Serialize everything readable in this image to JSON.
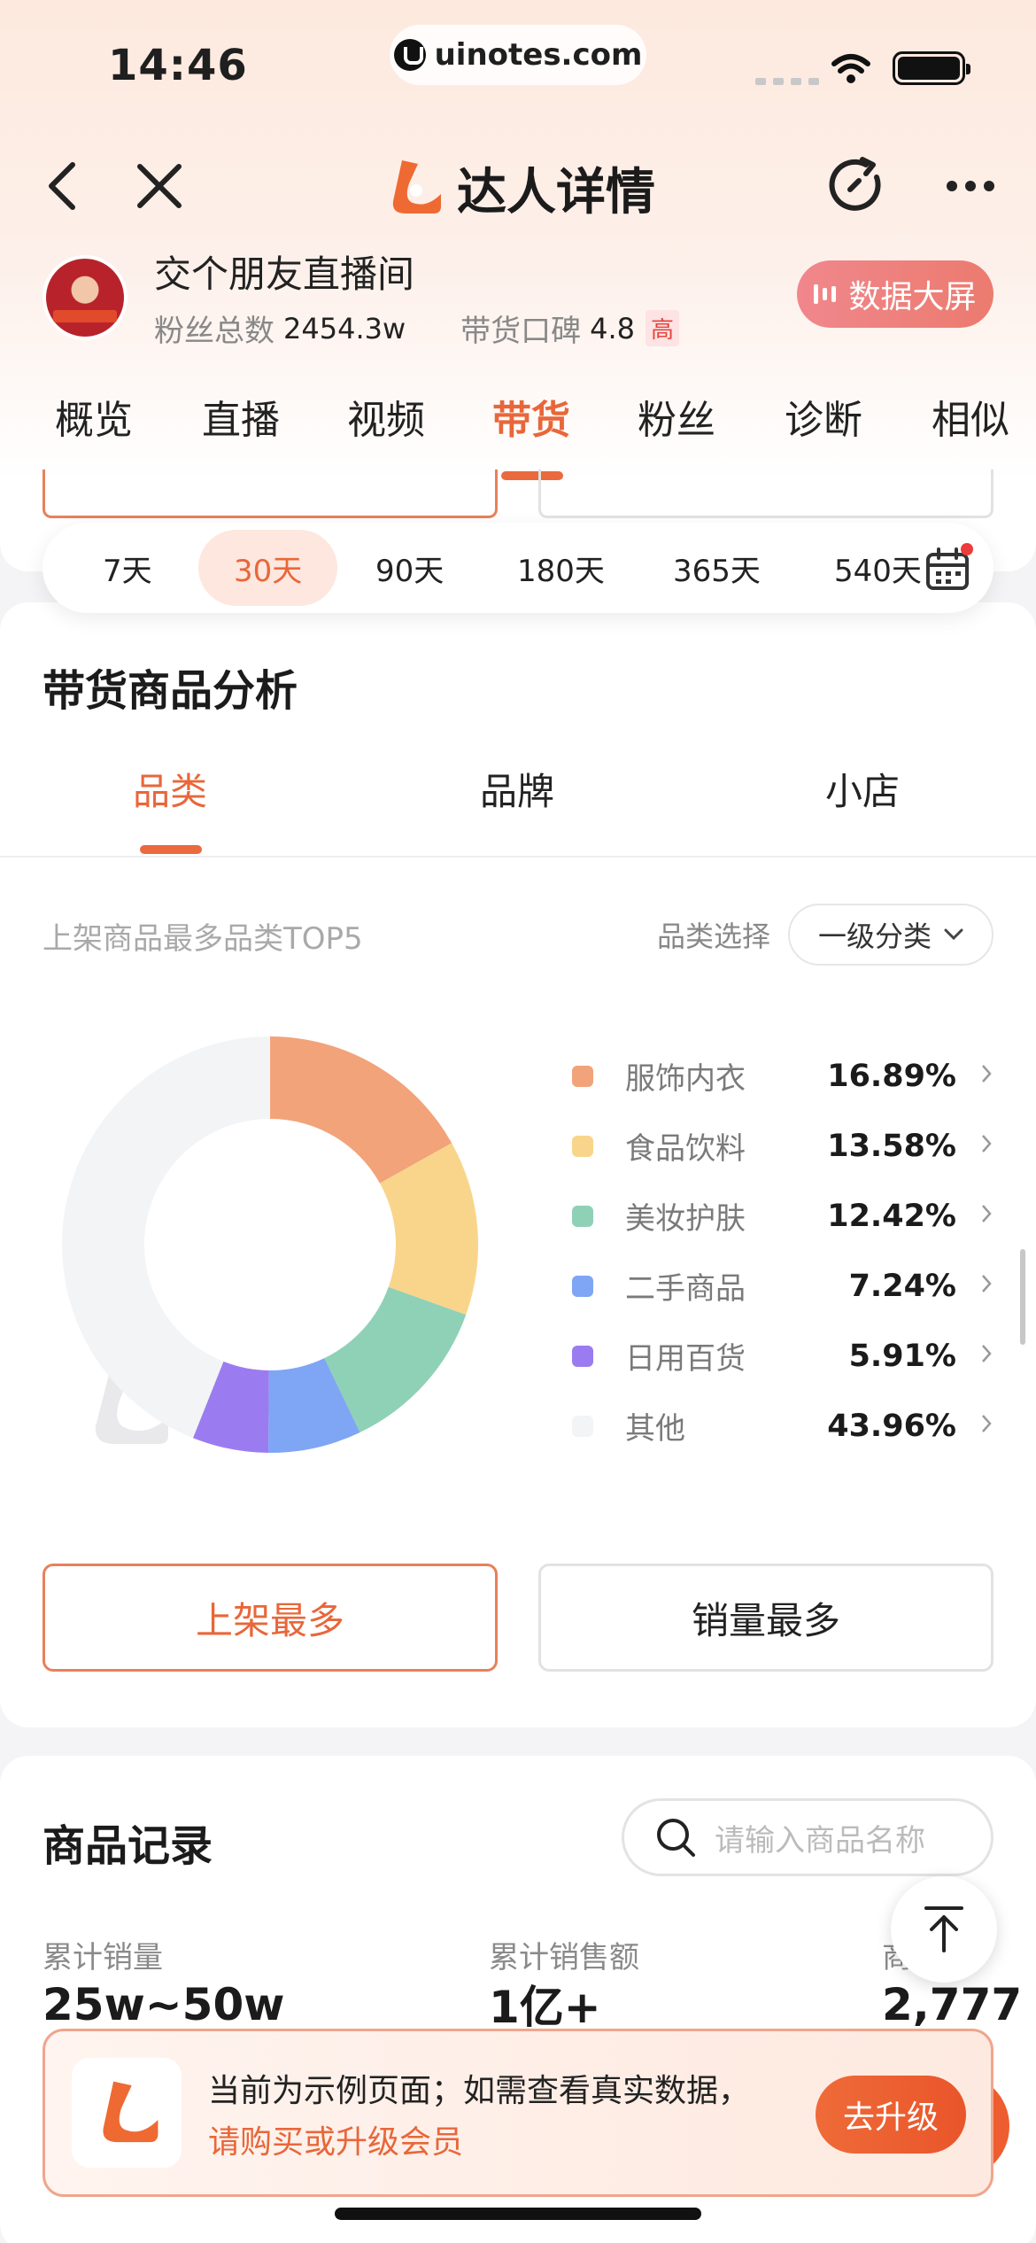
{
  "status_bar": {
    "time": "14:46",
    "url": "uinotes.com"
  },
  "nav": {
    "title": "达人详情"
  },
  "profile": {
    "name": "交个朋友直播间",
    "fans_label": "粉丝总数",
    "fans_value": "2454.3w",
    "reputation_label": "带货口碑",
    "reputation_value": "4.8",
    "reputation_badge": "高",
    "big_screen_label": "数据大屏"
  },
  "tabs": [
    "概览",
    "直播",
    "视频",
    "带货",
    "粉丝",
    "诊断",
    "相似"
  ],
  "active_tab": "带货",
  "time_ranges": [
    "7天",
    "30天",
    "90天",
    "180天",
    "365天",
    "540天"
  ],
  "active_range": "30天",
  "goods_analysis": {
    "title": "带货商品分析",
    "sub_tabs": [
      "品类",
      "品牌",
      "小店"
    ],
    "active_sub_tab": "品类",
    "top5_label": "上架商品最多品类TOP5",
    "category_select_label": "品类选择",
    "category_select_value": "一级分类",
    "btn_most_listed": "上架最多",
    "btn_most_sold": "销量最多"
  },
  "chart_data": {
    "type": "pie",
    "categories": [
      "服饰内衣",
      "食品饮料",
      "美妆护肤",
      "二手商品",
      "日用百货",
      "其他"
    ],
    "values": [
      16.89,
      13.58,
      12.42,
      7.24,
      5.91,
      43.96
    ],
    "value_labels": [
      "16.89%",
      "13.58%",
      "12.42%",
      "7.24%",
      "5.91%",
      "43.96%"
    ],
    "colors": [
      "#f2a37a",
      "#f9d58b",
      "#8fd1b6",
      "#7ea6f4",
      "#9b7cf0",
      "#f3f4f6"
    ],
    "legend_position": "right"
  },
  "product_records": {
    "title": "商品记录",
    "search_placeholder": "请输入商品名称",
    "metrics": [
      {
        "label": "累计销量",
        "value": "25w~50w"
      },
      {
        "label": "累计销售额",
        "value": "1亿+"
      },
      {
        "label": "商品数",
        "value": "2,777"
      }
    ]
  },
  "upgrade_banner": {
    "line1": "当前为示例页面；如需查看真实数据，",
    "line2": "请购买或升级会员",
    "button": "去升级"
  },
  "colors": {
    "accent": "#e8673a",
    "brand_orange": "#ee6a32"
  }
}
